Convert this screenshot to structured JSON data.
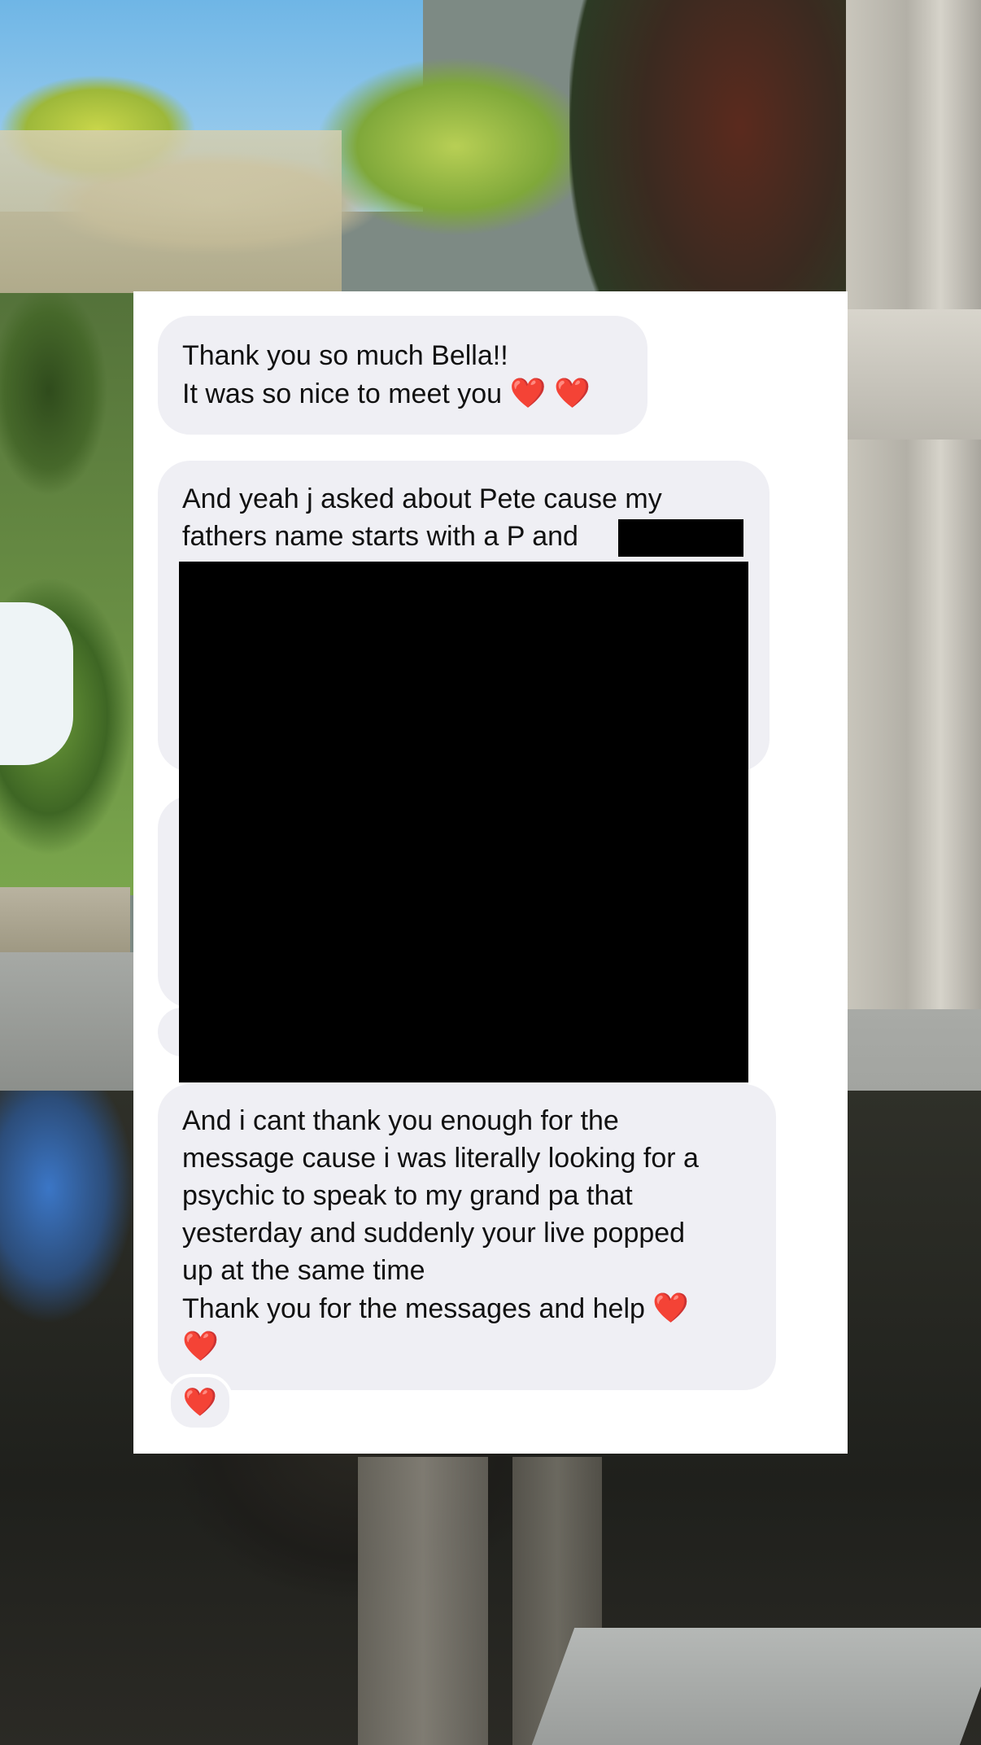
{
  "messages": [
    {
      "lines": [
        "Thank you so much Bella!!",
        "It was so nice to meet you"
      ],
      "trailing_emoji": "❤️ ❤️"
    },
    {
      "lines": [
        "And yeah j asked about Pete cause my",
        "fathers name starts with a P and"
      ],
      "redacted": true
    },
    {
      "lines": [
        "And i cant thank you enough for the",
        "message cause i was literally looking for a",
        "psychic to speak to my grand pa that",
        "yesterday and suddenly your live popped",
        "up at the same time",
        "Thank you for the messages and help"
      ],
      "trailing_emoji": "❤️",
      "extra_emoji_line": "❤️"
    }
  ],
  "reaction": "❤️",
  "icons": [
    "heart-emoji"
  ]
}
